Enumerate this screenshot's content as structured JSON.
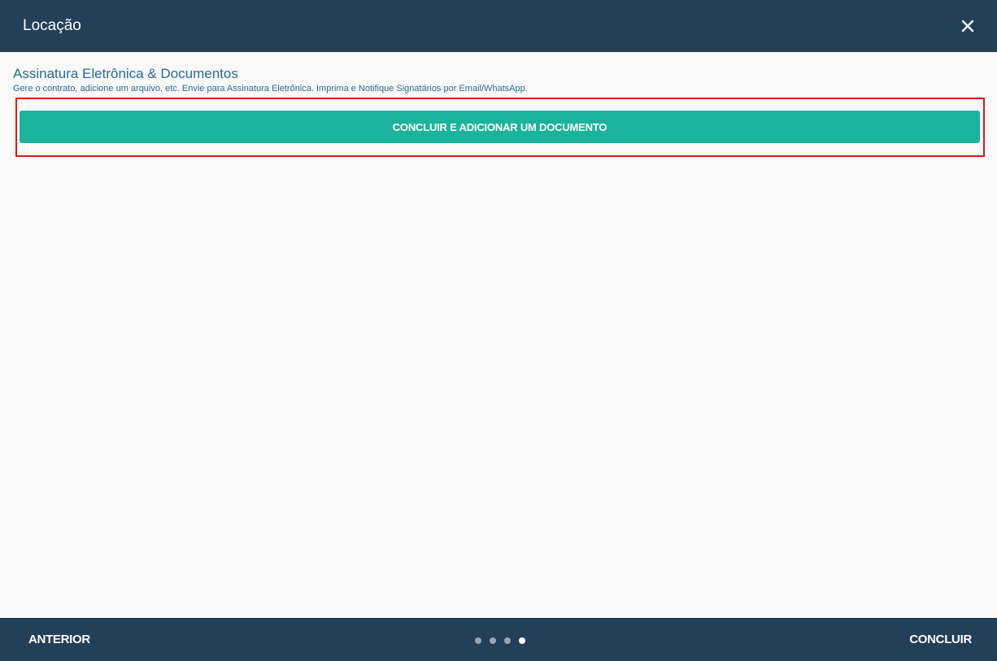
{
  "header": {
    "title": "Locação",
    "close_icon": "close-icon"
  },
  "section": {
    "title": "Assinatura Eletrônica & Documentos",
    "subtitle": "Gere o contrato, adicione um arquivo, etc. Envie para Assinatura Eletrônica. Imprima e Notifique Signatários por Email/WhatsApp."
  },
  "actions": {
    "add_document_label": "CONCLUIR E ADICIONAR UM DOCUMENTO"
  },
  "footer": {
    "prev_label": "ANTERIOR",
    "next_label": "CONCLUIR",
    "steps_total": 4,
    "current_step": 4
  },
  "colors": {
    "header_bg": "#243f58",
    "accent": "#1bb39c",
    "title_text": "#2a6a94",
    "highlight": "#e01818"
  }
}
